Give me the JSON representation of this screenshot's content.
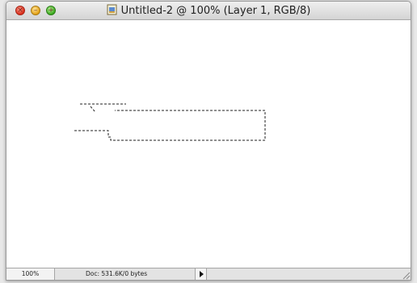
{
  "window": {
    "title": "Untitled-2 @ 100% (Layer 1, RGB/8)",
    "controls": [
      "close-icon",
      "minimize-icon",
      "zoom-icon"
    ]
  },
  "statusbar": {
    "zoom": "100%",
    "doc_info": "Doc: 531.6K/0 bytes",
    "menu_arrow_icon": "triangle-right-icon"
  },
  "colors": {
    "close": "#d92a17",
    "minimize": "#e4a013",
    "zoom": "#3aa81d"
  }
}
